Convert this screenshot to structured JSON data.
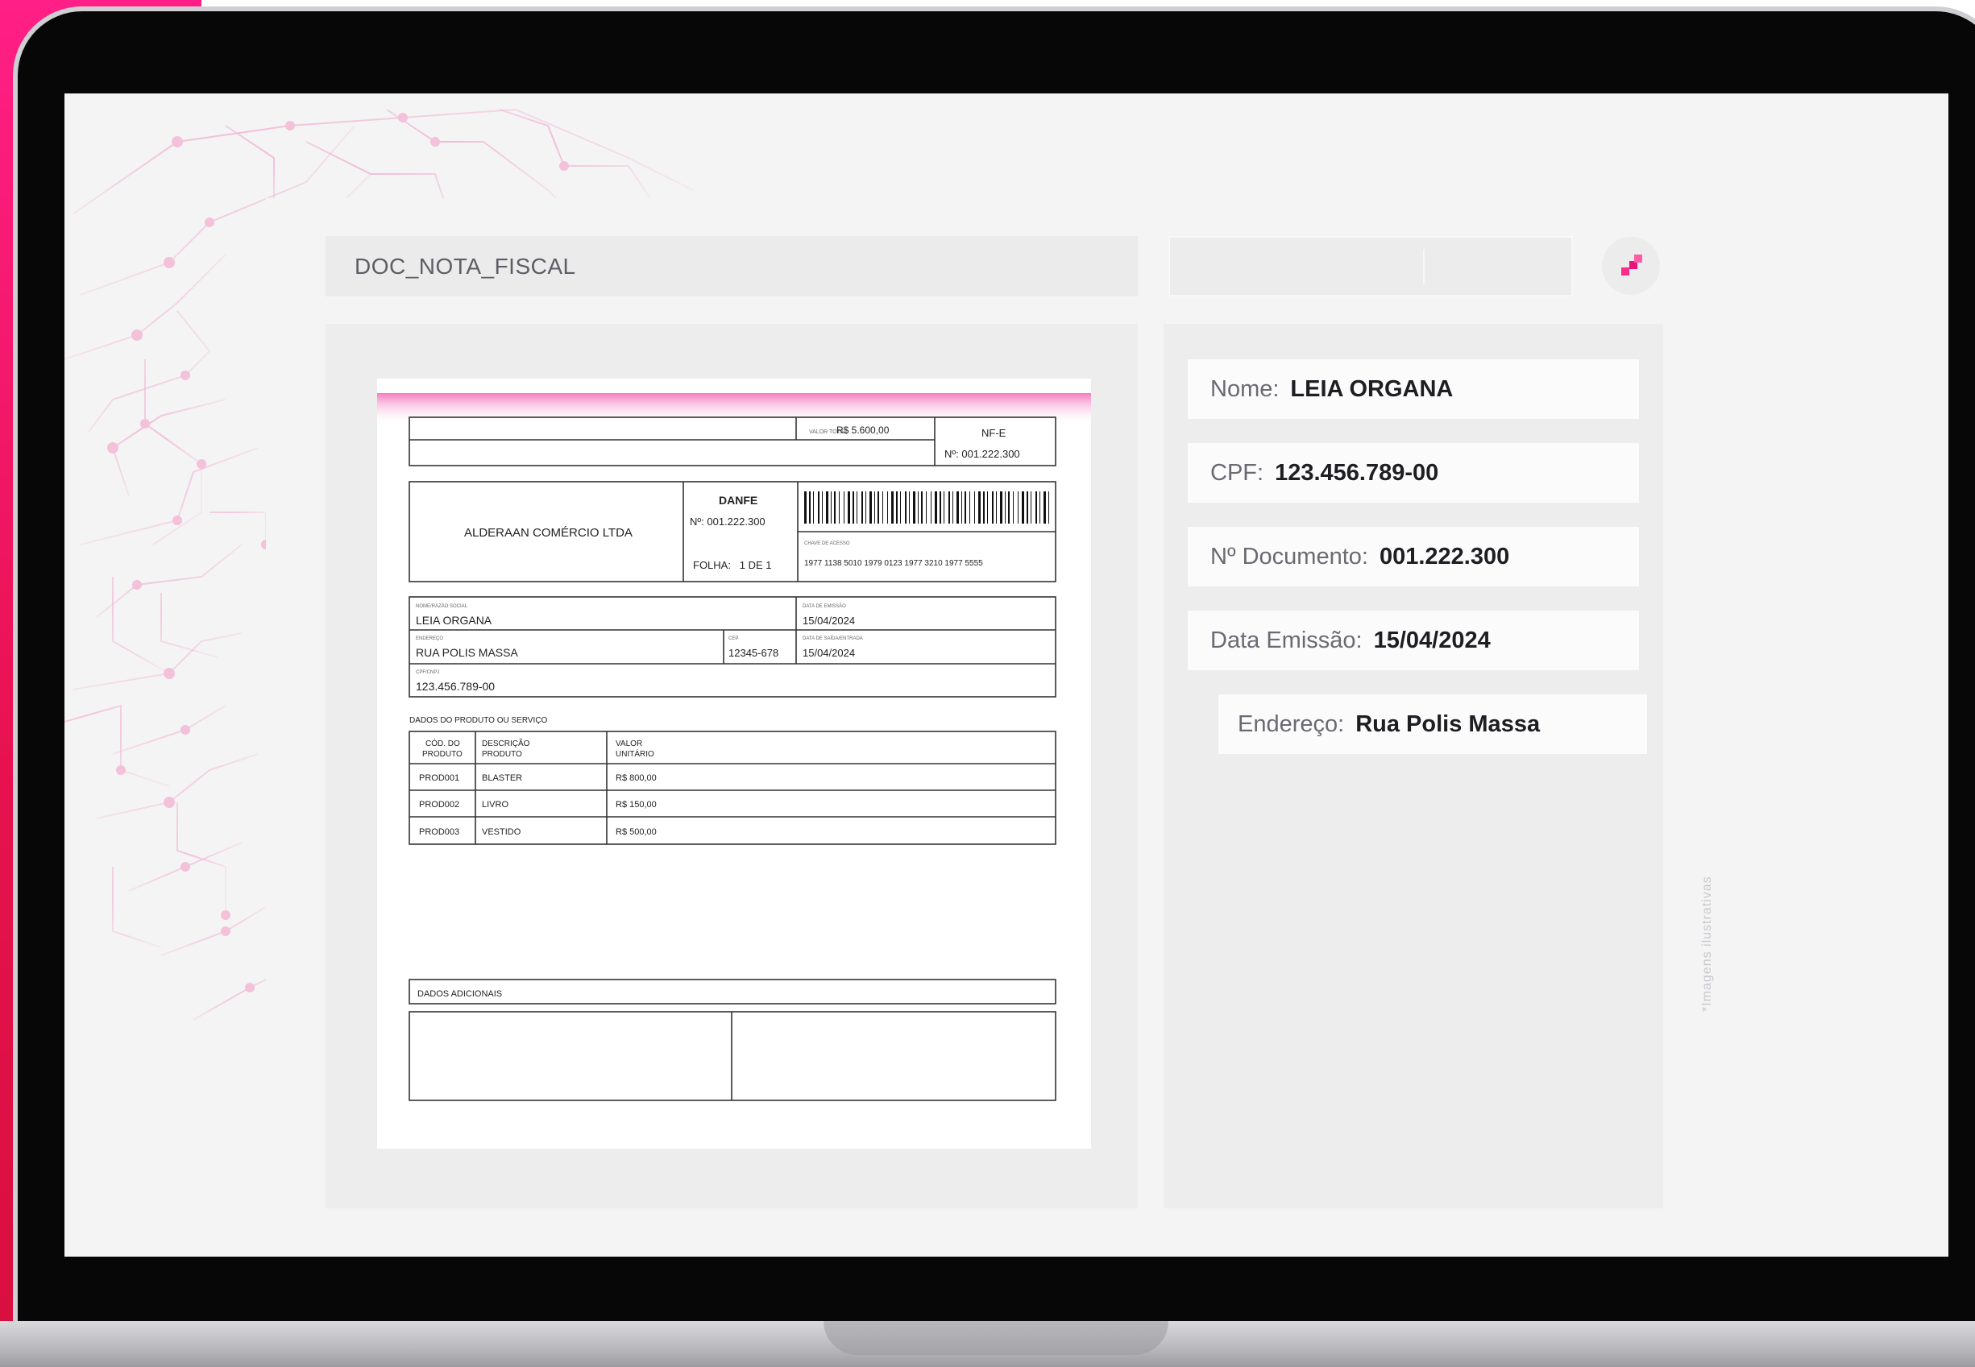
{
  "doc_title": "DOC_NOTA_FISCAL",
  "fields": [
    {
      "label": "Nome:",
      "value": "LEIA ORGANA"
    },
    {
      "label": "CPF:",
      "value": "123.456.789-00"
    },
    {
      "label": "Nº Documento:",
      "value": "001.222.300"
    },
    {
      "label": "Data Emissão:",
      "value": "15/04/2024"
    },
    {
      "label": "Endereço:",
      "value": "Rua Polis Massa"
    }
  ],
  "side_note": "*Imagens ilustrativas",
  "document": {
    "total_value": "R$ 5.600,00",
    "nfe_label": "NF-E",
    "nfe_number": "Nº: 001.222.300",
    "company": "ALDERAAN COMÉRCIO LTDA",
    "danfe_label": "DANFE",
    "danfe_number": "Nº: 001.222.300",
    "folha": "FOLHA:   1 DE 1",
    "access_key": "1977 1138 5010 1979 0123 1977 3210 1977 5555",
    "recipient_name": "LEIA ORGANA",
    "emission_date": "15/04/2024",
    "address": "RUA POLIS MASSA",
    "cep": "12345-678",
    "exit_date": "15/04/2024",
    "cpf": "123.456.789-00",
    "products_title": "DADOS DO PRODUTO OU SERVIÇO",
    "col_code": [
      "CÓD. DO",
      "PRODUTO"
    ],
    "col_desc": [
      "DESCRIÇÃO",
      "PRODUTO"
    ],
    "col_value": [
      "VALOR",
      "UNITÁRIO"
    ],
    "products": [
      {
        "code": "PROD001",
        "desc": "BLASTER",
        "value": "R$ 800,00"
      },
      {
        "code": "PROD002",
        "desc": "LIVRO",
        "value": "R$ 150,00"
      },
      {
        "code": "PROD003",
        "desc": "VESTIDO",
        "value": "R$ 500,00"
      }
    ],
    "additional_title": "DADOS ADICIONAIS"
  },
  "colors": {
    "accent": "#ff1f86",
    "accent_dark": "#d8103f"
  }
}
